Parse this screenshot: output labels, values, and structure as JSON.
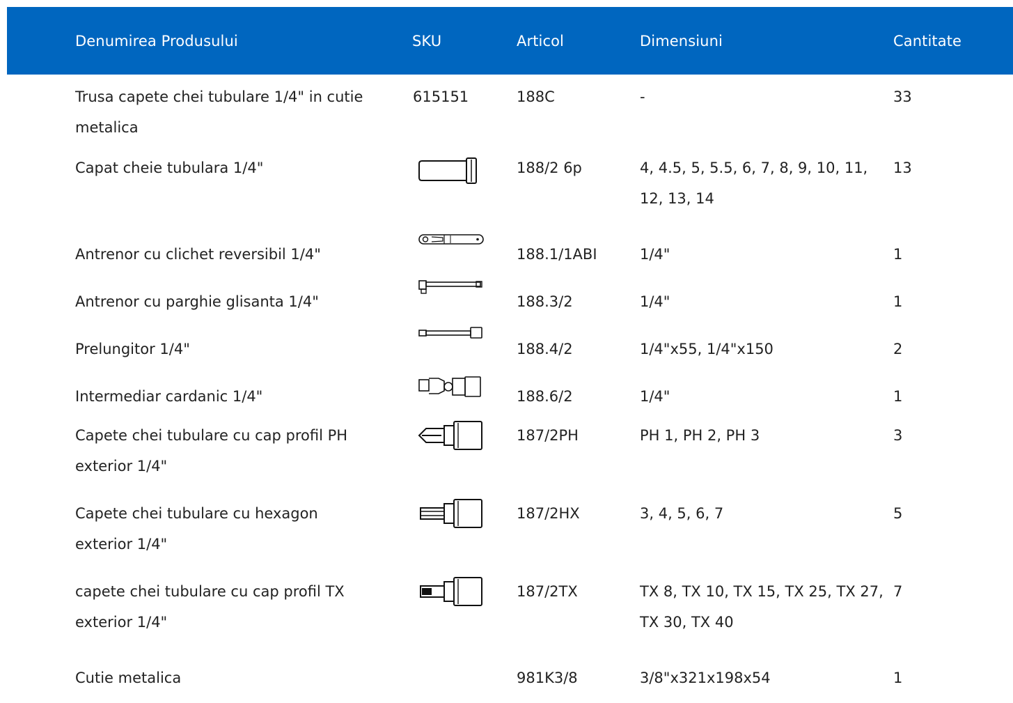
{
  "table": {
    "headers": {
      "name": "Denumirea Produsului",
      "sku": "SKU",
      "article": "Articol",
      "dimensions": "Dimensiuni",
      "quantity": "Cantitate"
    },
    "rows": [
      {
        "name": "Trusa capete chei tubulare 1/4\" in cutie metalica",
        "sku": "615151",
        "sku_icon": "",
        "article": "188C",
        "dimensions": "-",
        "quantity": "33"
      },
      {
        "name": "Capat cheie tubulara 1/4\"",
        "sku": "",
        "sku_icon": "socket-icon",
        "article": "188/2 6p",
        "dimensions": "4, 4.5, 5, 5.5, 6, 7, 8, 9, 10, 11, 12, 13, 14",
        "quantity": "13"
      },
      {
        "name": "Antrenor cu clichet reversibil 1/4\"",
        "sku": "",
        "sku_icon": "ratchet-icon",
        "article": "188.1/1ABI",
        "dimensions": "1/4\"",
        "quantity": "1"
      },
      {
        "name": "Antrenor cu parghie glisanta 1/4\"",
        "sku": "",
        "sku_icon": "sliding-t-bar-icon",
        "article": "188.3/2",
        "dimensions": "1/4\"",
        "quantity": "1"
      },
      {
        "name": "Prelungitor 1/4\"",
        "sku": "",
        "sku_icon": "extension-bar-icon",
        "article": "188.4/2",
        "dimensions": "1/4\"x55, 1/4\"x150",
        "quantity": "2"
      },
      {
        "name": "Intermediar cardanic 1/4\"",
        "sku": "",
        "sku_icon": "universal-joint-icon",
        "article": "188.6/2",
        "dimensions": "1/4\"",
        "quantity": "1"
      },
      {
        "name": "Capete chei tubulare cu cap profil PH exterior 1/4\"",
        "sku": "",
        "sku_icon": "ph-bit-socket-icon",
        "article": "187/2PH",
        "dimensions": "PH 1, PH 2, PH 3",
        "quantity": "3"
      },
      {
        "name": "Capete chei tubulare cu hexagon exterior 1/4\"",
        "sku": "",
        "sku_icon": "hex-bit-socket-icon",
        "article": "187/2HX",
        "dimensions": "3, 4, 5, 6, 7",
        "quantity": "5"
      },
      {
        "name": "capete chei tubulare cu cap profil TX exterior 1/4\"",
        "sku": "",
        "sku_icon": "tx-bit-socket-icon",
        "article": "187/2TX",
        "dimensions": "TX 8, TX 10, TX 15, TX 25, TX 27, TX 30, TX 40",
        "quantity": "7"
      },
      {
        "name": "Cutie metalica",
        "sku": "",
        "sku_icon": "",
        "article": "981K3/8",
        "dimensions": "3/8\"x321x198x54",
        "quantity": "1"
      }
    ]
  },
  "colors": {
    "header_background": "#0066bf",
    "header_text": "#ffffff",
    "body_text": "#222222"
  }
}
